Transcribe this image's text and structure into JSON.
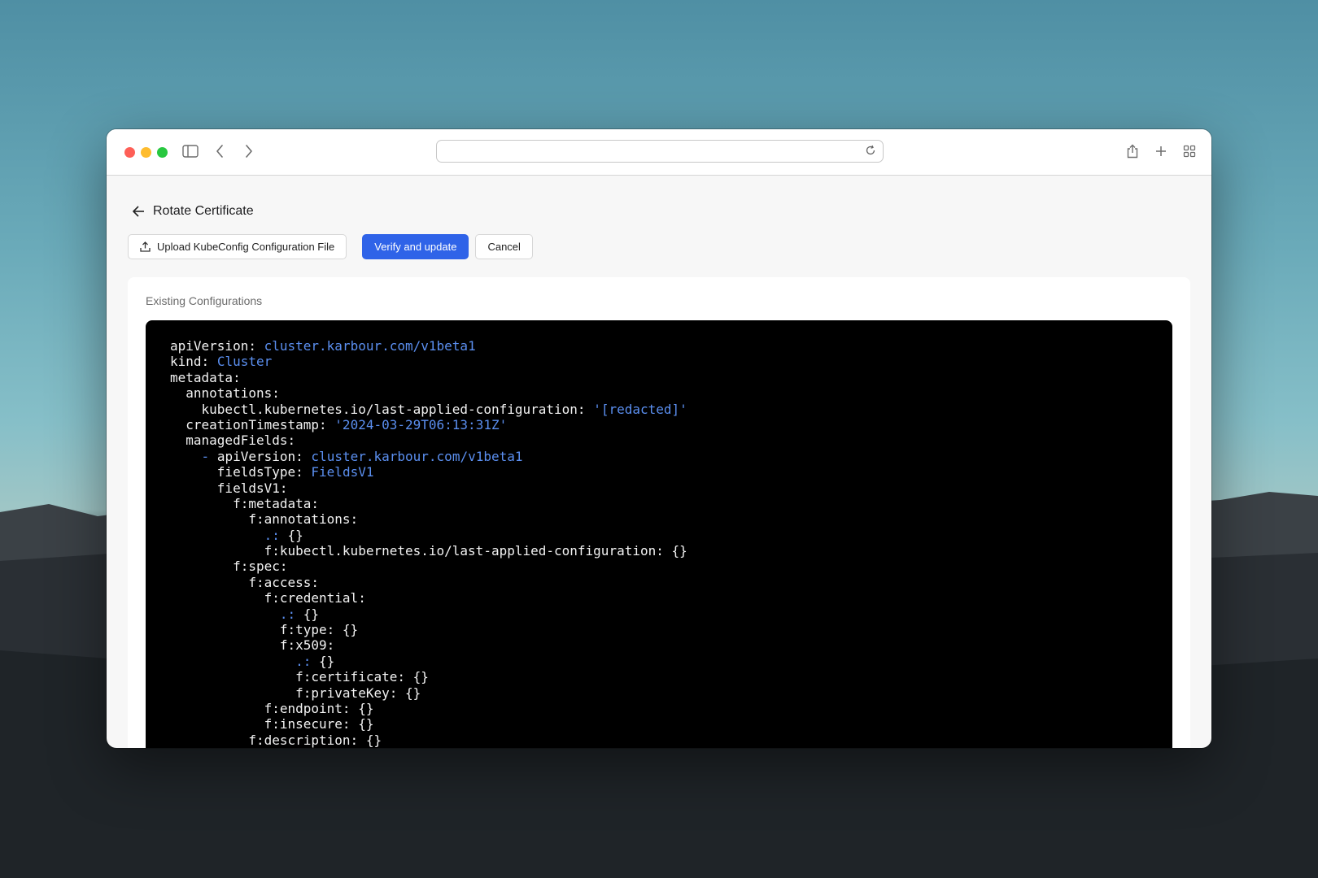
{
  "browser": {
    "url": "",
    "icons": [
      "sidebar-icon",
      "back-icon",
      "forward-icon",
      "reload-icon",
      "share-icon",
      "new-tab-icon",
      "tab-overview-icon"
    ]
  },
  "page": {
    "title": "Rotate Certificate",
    "upload_label": "Upload KubeConfig Configuration File",
    "verify_label": "Verify and update",
    "cancel_label": "Cancel",
    "section_label": "Existing Configurations"
  },
  "colors": {
    "primary": "#2f63e8",
    "code_background": "#000000",
    "code_value": "#5b8ff0"
  },
  "code_lines": [
    {
      "indent": "",
      "key": "apiVersion:",
      "value": "cluster.karbour.com/v1beta1"
    },
    {
      "indent": "",
      "key": "kind:",
      "value": "Cluster"
    },
    {
      "indent": "",
      "key": "metadata:",
      "value": ""
    },
    {
      "indent": "  ",
      "key": "annotations:",
      "value": ""
    },
    {
      "indent": "    ",
      "key": "kubectl.kubernetes.io/last-applied-configuration:",
      "value": "'[redacted]'"
    },
    {
      "indent": "  ",
      "key": "creationTimestamp:",
      "value": "'2024-03-29T06:13:31Z'"
    },
    {
      "indent": "  ",
      "key": "managedFields:",
      "value": ""
    },
    {
      "indent": "    ",
      "dash": "-",
      "key": "apiVersion:",
      "value": "cluster.karbour.com/v1beta1"
    },
    {
      "indent": "      ",
      "key": "fieldsType:",
      "value": "FieldsV1"
    },
    {
      "indent": "      ",
      "key": "fieldsV1:",
      "value": ""
    },
    {
      "indent": "        ",
      "key": "f:metadata:",
      "value": ""
    },
    {
      "indent": "          ",
      "key": "f:annotations:",
      "value": ""
    },
    {
      "indent": "            ",
      "dot": ".:",
      "key": "{}",
      "value": ""
    },
    {
      "indent": "            ",
      "key": "f:kubectl.kubernetes.io/last-applied-configuration: {}",
      "value": ""
    },
    {
      "indent": "        ",
      "key": "f:spec:",
      "value": ""
    },
    {
      "indent": "          ",
      "key": "f:access:",
      "value": ""
    },
    {
      "indent": "            ",
      "key": "f:credential:",
      "value": ""
    },
    {
      "indent": "              ",
      "dot": ".:",
      "key": "{}",
      "value": ""
    },
    {
      "indent": "              ",
      "key": "f:type: {}",
      "value": ""
    },
    {
      "indent": "              ",
      "key": "f:x509:",
      "value": ""
    },
    {
      "indent": "                ",
      "dot": ".:",
      "key": "{}",
      "value": ""
    },
    {
      "indent": "                ",
      "key": "f:certificate: {}",
      "value": ""
    },
    {
      "indent": "                ",
      "key": "f:privateKey: {}",
      "value": ""
    },
    {
      "indent": "            ",
      "key": "f:endpoint: {}",
      "value": ""
    },
    {
      "indent": "            ",
      "key": "f:insecure: {}",
      "value": ""
    },
    {
      "indent": "          ",
      "key": "f:description: {}",
      "value": ""
    }
  ]
}
